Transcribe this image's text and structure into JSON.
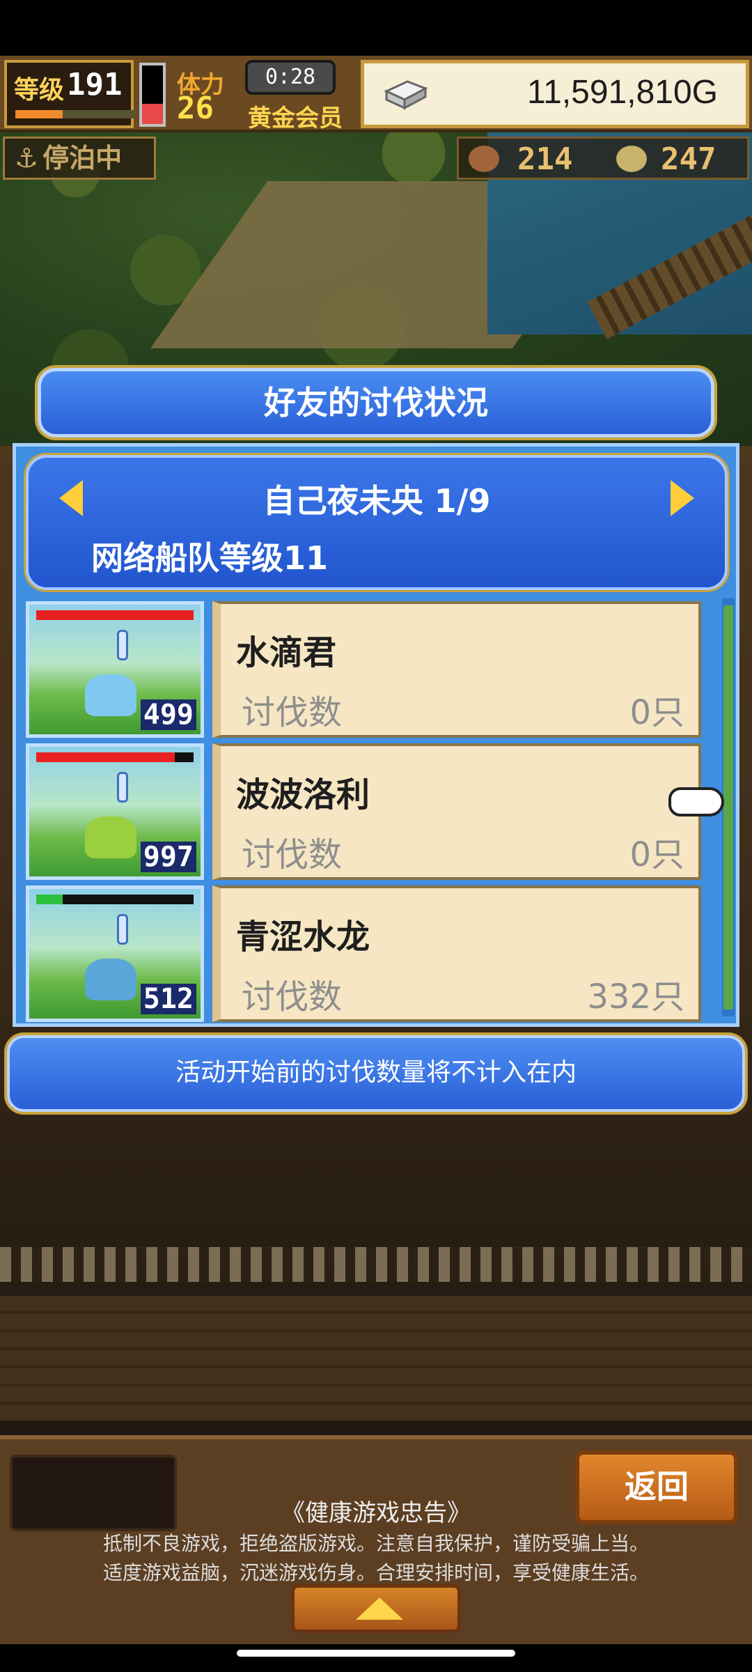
{
  "hud": {
    "level_label": "等级",
    "level": "191",
    "level_progress": 0.4,
    "hp_fraction": 0.35,
    "stamina_label": "体力",
    "stamina": "26",
    "timer": "0:28",
    "membership": "黄金会员",
    "money": "11,591,810G",
    "docked": "停泊中",
    "resource1": "214",
    "resource2": "247"
  },
  "dialog": {
    "title": "好友的讨伐状况",
    "friend_name": "自己夜未央 1/9",
    "fleet_level": "网络船队等级11",
    "note": "活动开始前的讨伐数量将不计入在内"
  },
  "monsters": [
    {
      "name": "水滴君",
      "kill_label": "讨伐数",
      "kills": "0只",
      "level": "499",
      "hp_fraction": 1.0,
      "hp_color": "#e82020",
      "body_color": "#7fc8f0"
    },
    {
      "name": "波波洛利",
      "kill_label": "讨伐数",
      "kills": "0只",
      "level": "997",
      "hp_fraction": 0.88,
      "hp_color": "#e82020",
      "body_color": "#9ad040"
    },
    {
      "name": "青涩水龙",
      "kill_label": "讨伐数",
      "kills": "332只",
      "level": "512",
      "hp_fraction": 0.17,
      "hp_color": "#30c040",
      "body_color": "#5aa6d8"
    }
  ],
  "bottom": {
    "back": "返回",
    "health_title": "《健康游戏忠告》",
    "health_line1": "抵制不良游戏，拒绝盗版游戏。注意自我保护，谨防受骗上当。",
    "health_line2": "适度游戏益脑，沉迷游戏伤身。合理安排时间，享受健康生活。"
  },
  "icons": {
    "prev": "arrow-left-icon",
    "next": "arrow-right-icon",
    "money": "silver-bar-icon",
    "docked": "anchor-icon",
    "pointer": "pointing-hand-icon"
  }
}
